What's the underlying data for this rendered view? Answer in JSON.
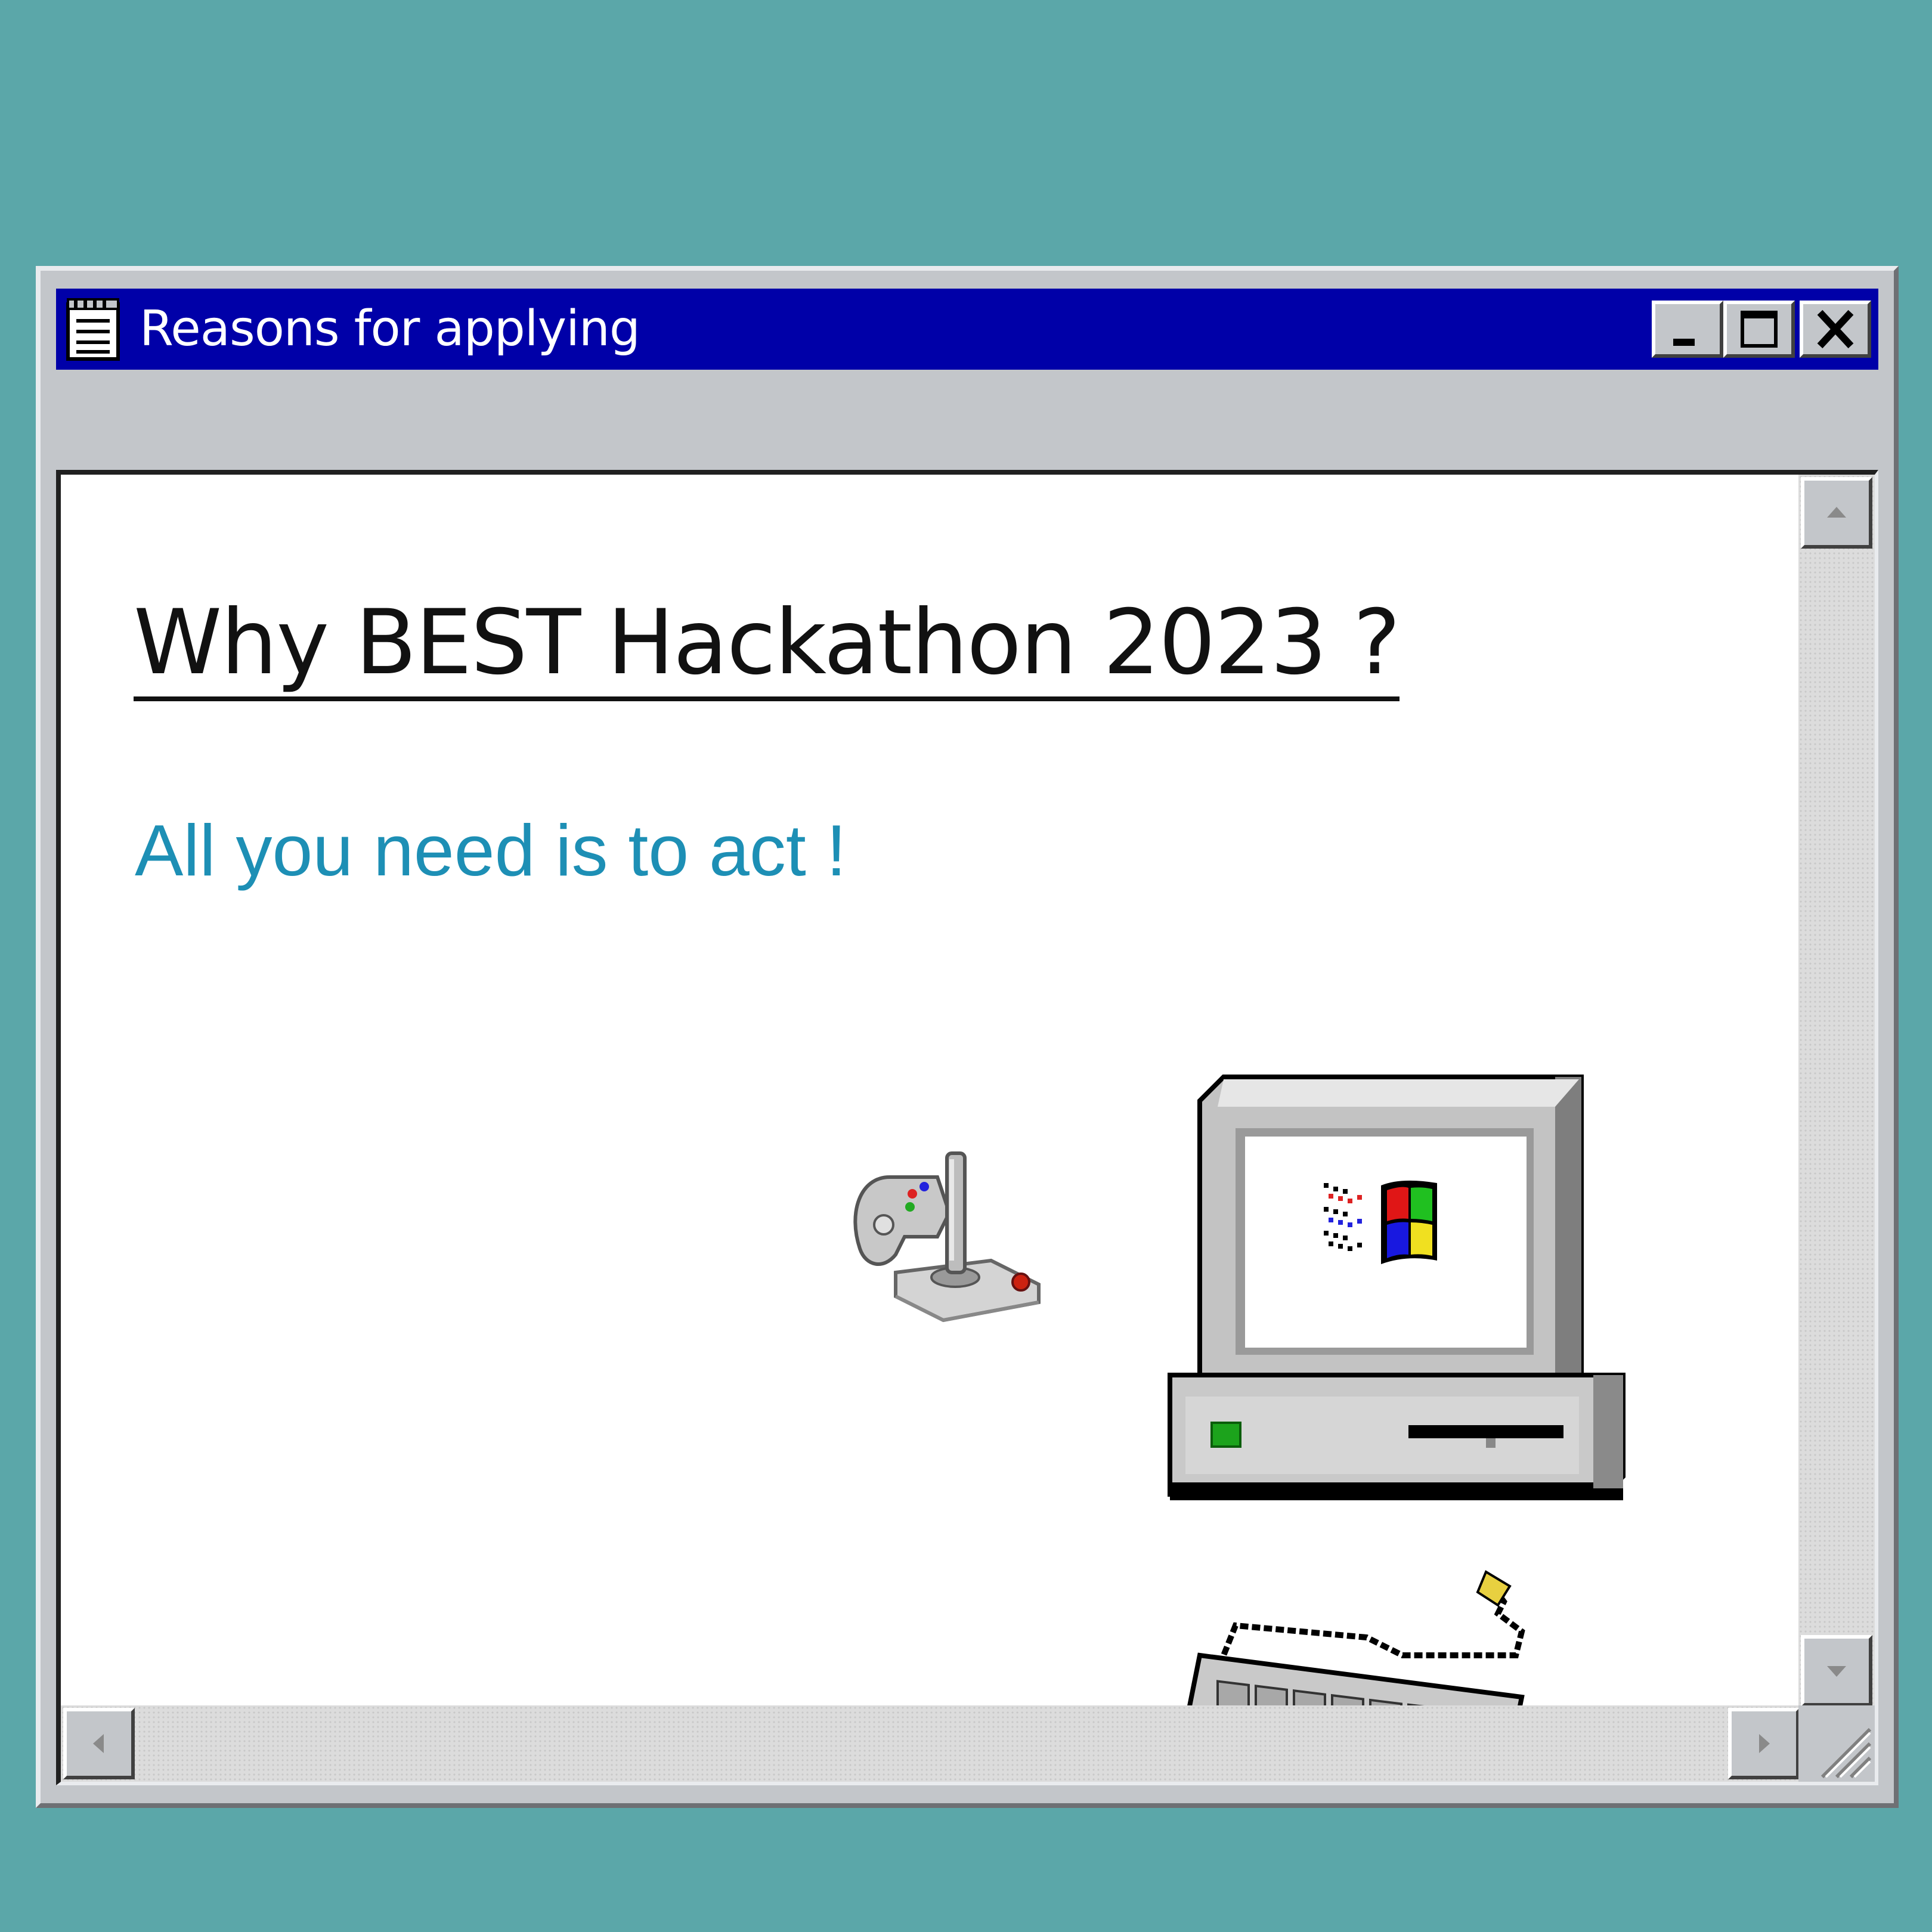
{
  "window": {
    "title": "Reasons for applying",
    "title_icon": "notepad-icon",
    "controls": {
      "minimize": "minimize-icon",
      "maximize": "maximize-icon",
      "close": "close-icon"
    }
  },
  "content": {
    "heading": "Why BEST Hackathon 2023 ?",
    "tagline": "All you need is to act !"
  },
  "illustration": {
    "items": [
      "computer-icon",
      "joystick-icon",
      "keyboard-icon",
      "windows-logo-icon"
    ]
  },
  "scrollbars": {
    "up": "arrow-up-icon",
    "down": "arrow-down-icon",
    "left": "arrow-left-icon",
    "right": "arrow-right-icon",
    "grip": "resize-grip-icon"
  },
  "colors": {
    "desktop": "#5ba7a9",
    "titlebar": "#0000a8",
    "tagline": "#1d8fb5",
    "window": "#c3c6ca"
  }
}
